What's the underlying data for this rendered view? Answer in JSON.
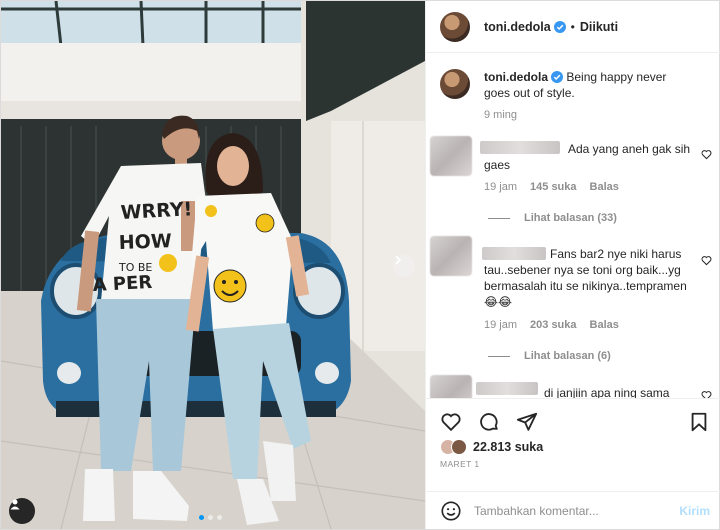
{
  "post": {
    "username": "toni.dedola",
    "follow_status": "Diikuti",
    "separator": "•",
    "caption": "Being happy never goes out of style.",
    "caption_age": "9 ming",
    "likes": "22.813 suka",
    "date": "MARET 1",
    "shirt_text": [
      "WRRY!",
      "HOW",
      "TO BE",
      "A PER"
    ],
    "carousel": {
      "total": 3,
      "active": 1
    }
  },
  "comments": [
    {
      "text": "Ada yang aneh gak sih gaes",
      "age": "19 jam",
      "likes": "145 suka",
      "reply": "Balas",
      "view_replies": "Lihat balasan (33)"
    },
    {
      "text": "Fans bar2 nye niki harus tau..sebener nya se toni org baik...yg bermasalah itu se nikinya..tempramen 😂😂",
      "age": "19 jam",
      "likes": "203 suka",
      "reply": "Balas",
      "view_replies": "Lihat balasan (6)"
    },
    {
      "text": "di janjiin apa ning sama"
    }
  ],
  "composer": {
    "placeholder": "Tambahkan komentar...",
    "send_label": "Kirim"
  },
  "icons": {
    "verified": "verified-badge-icon",
    "like": "heart-icon",
    "comment": "comment-icon",
    "share": "send-icon",
    "save": "bookmark-icon",
    "emoji": "emoji-icon",
    "next": "chevron-right-icon",
    "tags": "user-tag-icon"
  },
  "colors": {
    "accent": "#0095f6",
    "send_disabled": "#b2dffc",
    "meta": "#8e8e8e",
    "verified": "#3897f0"
  }
}
